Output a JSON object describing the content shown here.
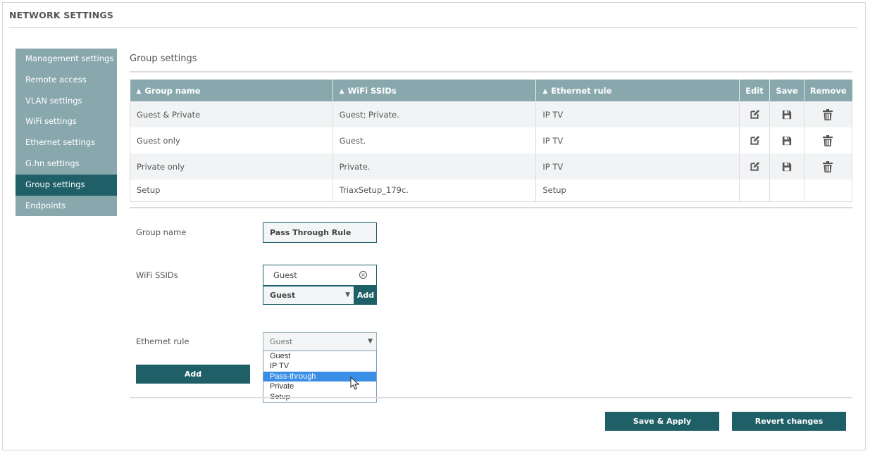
{
  "page_title": "NETWORK SETTINGS",
  "sidebar": {
    "items": [
      {
        "label": "Management settings",
        "active": false
      },
      {
        "label": "Remote access",
        "active": false
      },
      {
        "label": "VLAN settings",
        "active": false
      },
      {
        "label": "WiFi settings",
        "active": false
      },
      {
        "label": "Ethernet settings",
        "active": false
      },
      {
        "label": "G.hn settings",
        "active": false
      },
      {
        "label": "Group settings",
        "active": true
      },
      {
        "label": "Endpoints",
        "active": false
      }
    ]
  },
  "section_title": "Group settings",
  "table": {
    "headers": {
      "group_name": "Group name",
      "wifi_ssids": "WiFi SSIDs",
      "ethernet_rule": "Ethernet rule",
      "edit": "Edit",
      "save": "Save",
      "remove": "Remove"
    },
    "rows": [
      {
        "group_name": "Guest & Private",
        "wifi_ssids": "Guest; Private.",
        "ethernet_rule": "IP TV",
        "actions": true
      },
      {
        "group_name": "Guest only",
        "wifi_ssids": "Guest.",
        "ethernet_rule": "IP TV",
        "actions": true
      },
      {
        "group_name": "Private only",
        "wifi_ssids": "Private.",
        "ethernet_rule": "IP TV",
        "actions": true
      },
      {
        "group_name": "Setup",
        "wifi_ssids": "TriaxSetup_179c.",
        "ethernet_rule": "Setup",
        "actions": false
      }
    ]
  },
  "form": {
    "group_name_label": "Group name",
    "group_name_value": "Pass Through Rule",
    "wifi_ssids_label": "WiFi SSIDs",
    "wifi_tag": "Guest",
    "wifi_select_value": "Guest",
    "wifi_add_label": "Add",
    "ethernet_rule_label": "Ethernet rule",
    "ethernet_select_value": "Guest",
    "ethernet_options": [
      "Guest",
      "IP TV",
      "Pass-through",
      "Private",
      "Setup"
    ],
    "ethernet_highlighted": "Pass-through",
    "add_button": "Add"
  },
  "footer": {
    "save_apply": "Save & Apply",
    "revert": "Revert changes"
  },
  "colors": {
    "accent_dark": "#1f5f68",
    "accent_light": "#89a8ae",
    "highlight": "#3a8ee6"
  },
  "icons": {
    "sort": "chevron-up-icon",
    "edit": "edit-icon",
    "save": "floppy-disk-icon",
    "remove": "trash-icon",
    "clear": "close-circle-icon",
    "dropdown": "caret-down-icon"
  }
}
